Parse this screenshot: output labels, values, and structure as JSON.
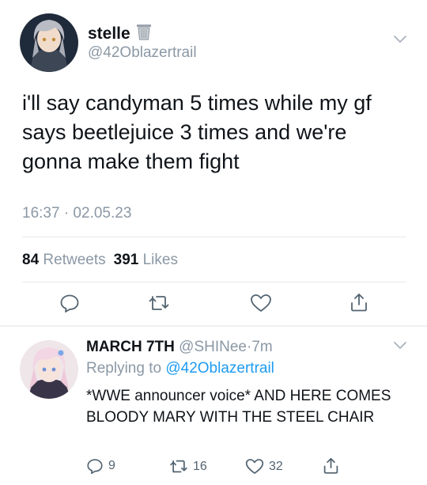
{
  "main_tweet": {
    "display_name": "stelle",
    "name_emoji": "trash-can-icon",
    "handle": "@42Oblazertrail",
    "text": "i'll say candyman 5 times while my gf says beetlejuice 3 times and we're gonna make them fight",
    "timestamp": "16:37 · 02.05.23",
    "retweets_count": "84",
    "retweets_label": "Retweets",
    "likes_count": "391",
    "likes_label": "Likes"
  },
  "reply": {
    "display_name": "MARCH 7TH",
    "handle": "@SHINee",
    "separator": "·",
    "age": "7m",
    "replying_prefix": "Replying to",
    "replying_handle": "@42Oblazertrail",
    "text": "*WWE announcer voice* AND HERE COMES BLOODY MARY WITH THE STEEL CHAIR",
    "reply_count": "9",
    "retweet_count": "16",
    "like_count": "32"
  },
  "colors": {
    "link": "#1d9bf0",
    "muted": "#8b98a5",
    "divider": "#e6e9ec"
  }
}
